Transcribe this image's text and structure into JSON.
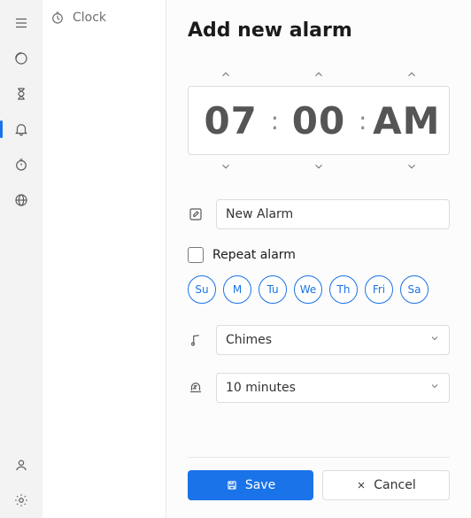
{
  "app": {
    "title": "Clock"
  },
  "rail": {
    "items": [
      {
        "name": "menu"
      },
      {
        "name": "focus-sessions"
      },
      {
        "name": "timer"
      },
      {
        "name": "alarm"
      },
      {
        "name": "stopwatch"
      },
      {
        "name": "world-clock"
      }
    ],
    "bottom": [
      {
        "name": "account"
      },
      {
        "name": "settings"
      }
    ]
  },
  "panel": {
    "title": "Add new alarm",
    "time": {
      "hour": "07",
      "minute": "00",
      "ampm": "AM"
    },
    "name_input": {
      "value": "New Alarm"
    },
    "repeat": {
      "label": "Repeat alarm",
      "checked": false
    },
    "days": [
      "Su",
      "M",
      "Tu",
      "We",
      "Th",
      "Fri",
      "Sa"
    ],
    "sound": {
      "value": "Chimes"
    },
    "snooze": {
      "value": "10 minutes"
    },
    "buttons": {
      "save": "Save",
      "cancel": "Cancel"
    }
  }
}
